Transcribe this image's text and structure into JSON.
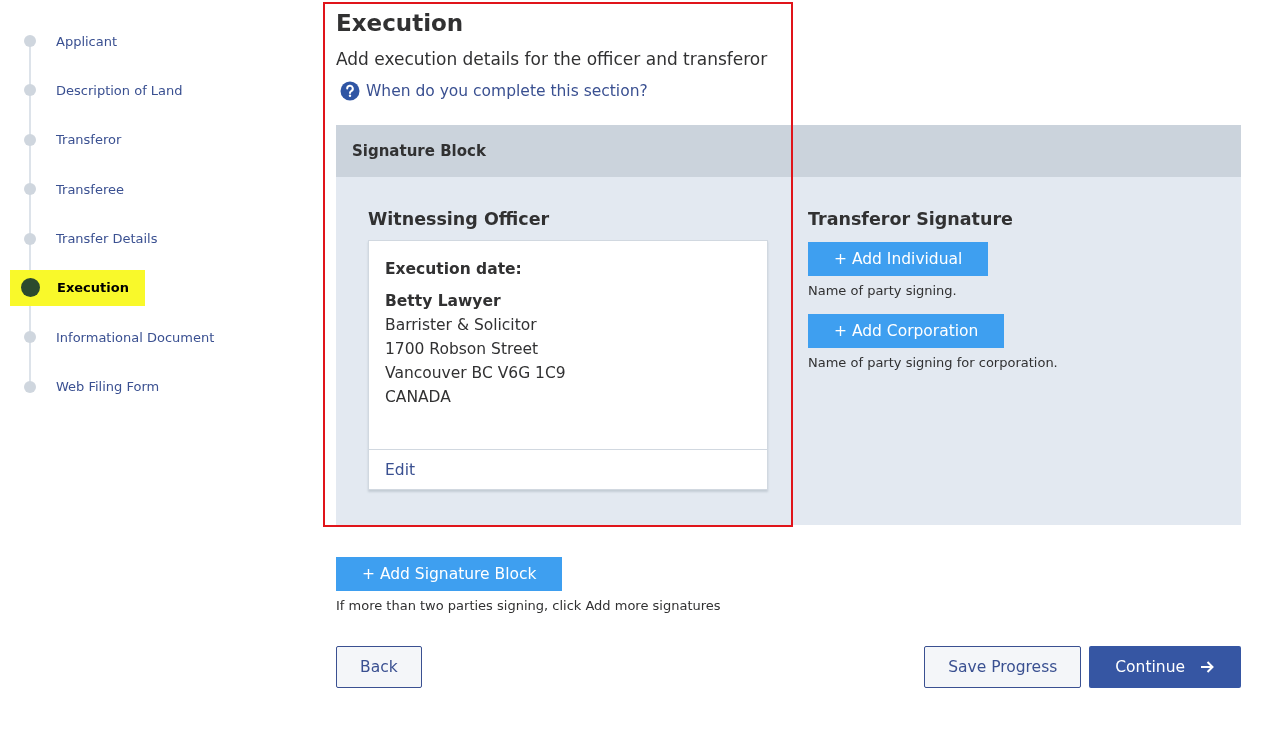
{
  "sidebar": {
    "items": [
      {
        "label": "Applicant",
        "selected": false
      },
      {
        "label": "Description of Land",
        "selected": false
      },
      {
        "label": "Transferor",
        "selected": false
      },
      {
        "label": "Transferee",
        "selected": false
      },
      {
        "label": "Transfer Details",
        "selected": false
      },
      {
        "label": "Execution",
        "selected": true
      },
      {
        "label": "Informational Document",
        "selected": false
      },
      {
        "label": "Web Filing Form",
        "selected": false
      }
    ]
  },
  "page": {
    "title": "Execution",
    "subtitle": "Add execution details for the officer and transferor",
    "help_link": "When do you complete this section?"
  },
  "signature_block": {
    "title": "Signature Block",
    "witnessing_officer": {
      "heading": "Witnessing Officer",
      "date_label": "Execution date:",
      "name": "Betty Lawyer",
      "lines": [
        "Barrister & Solicitor",
        "1700 Robson Street",
        "Vancouver BC V6G 1C9",
        "CANADA"
      ],
      "edit": "Edit"
    },
    "transferor_signature": {
      "heading": "Transferor Signature",
      "actions": [
        {
          "button": "+ Add Individual",
          "hint": "Name of party signing."
        },
        {
          "button": "+ Add Corporation",
          "hint": "Name of party signing for corporation."
        }
      ]
    }
  },
  "add_block": {
    "button": "+ Add Signature Block",
    "hint": "If more than two parties signing, click Add more signatures"
  },
  "footer": {
    "back": "Back",
    "save": "Save Progress",
    "continue": "Continue"
  }
}
